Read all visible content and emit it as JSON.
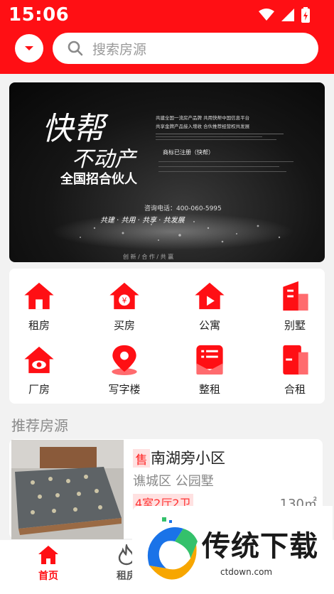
{
  "status_bar": {
    "time": "15:06"
  },
  "header": {
    "search_placeholder": "搜索房源"
  },
  "banner": {
    "title_line1": "快帮",
    "title_line2": "不动产",
    "subtitle": "全国招合伙人",
    "right_line1": "共建全国一流房产品牌 共用快帮中国信息平台",
    "right_line2": "共享金牌产品接入增收 合伙推荐经营权共发展",
    "trademark": "商标已注册（快帮）",
    "phone": "咨询电话：400-060-5995",
    "slogan": "共建 · 共用 · 共享 · 共发展",
    "footer": "创 新 / 合 作 / 共 赢"
  },
  "categories": [
    {
      "label": "租房",
      "icon": "house-icon"
    },
    {
      "label": "买房",
      "icon": "house-yen-icon"
    },
    {
      "label": "公寓",
      "icon": "house-play-icon"
    },
    {
      "label": "别墅",
      "icon": "building-icon"
    },
    {
      "label": "厂房",
      "icon": "house-eye-icon"
    },
    {
      "label": "写字楼",
      "icon": "location-pin-icon"
    },
    {
      "label": "整租",
      "icon": "list-card-icon"
    },
    {
      "label": "合租",
      "icon": "door-icon"
    }
  ],
  "section": {
    "title": "推荐房源"
  },
  "listing": {
    "tag": "售",
    "title": "南湖旁小区",
    "subtitle": "谯城区 公园墅",
    "rooms": "4室2厅2卫",
    "area": "130㎡"
  },
  "bottom_nav": {
    "home": "首页",
    "rent": "租房"
  },
  "watermark": {
    "text": "传统下载",
    "url": "ctdown.com"
  },
  "colors": {
    "brand": "#ff0f14",
    "tag_bg": "#ffe1e1"
  }
}
